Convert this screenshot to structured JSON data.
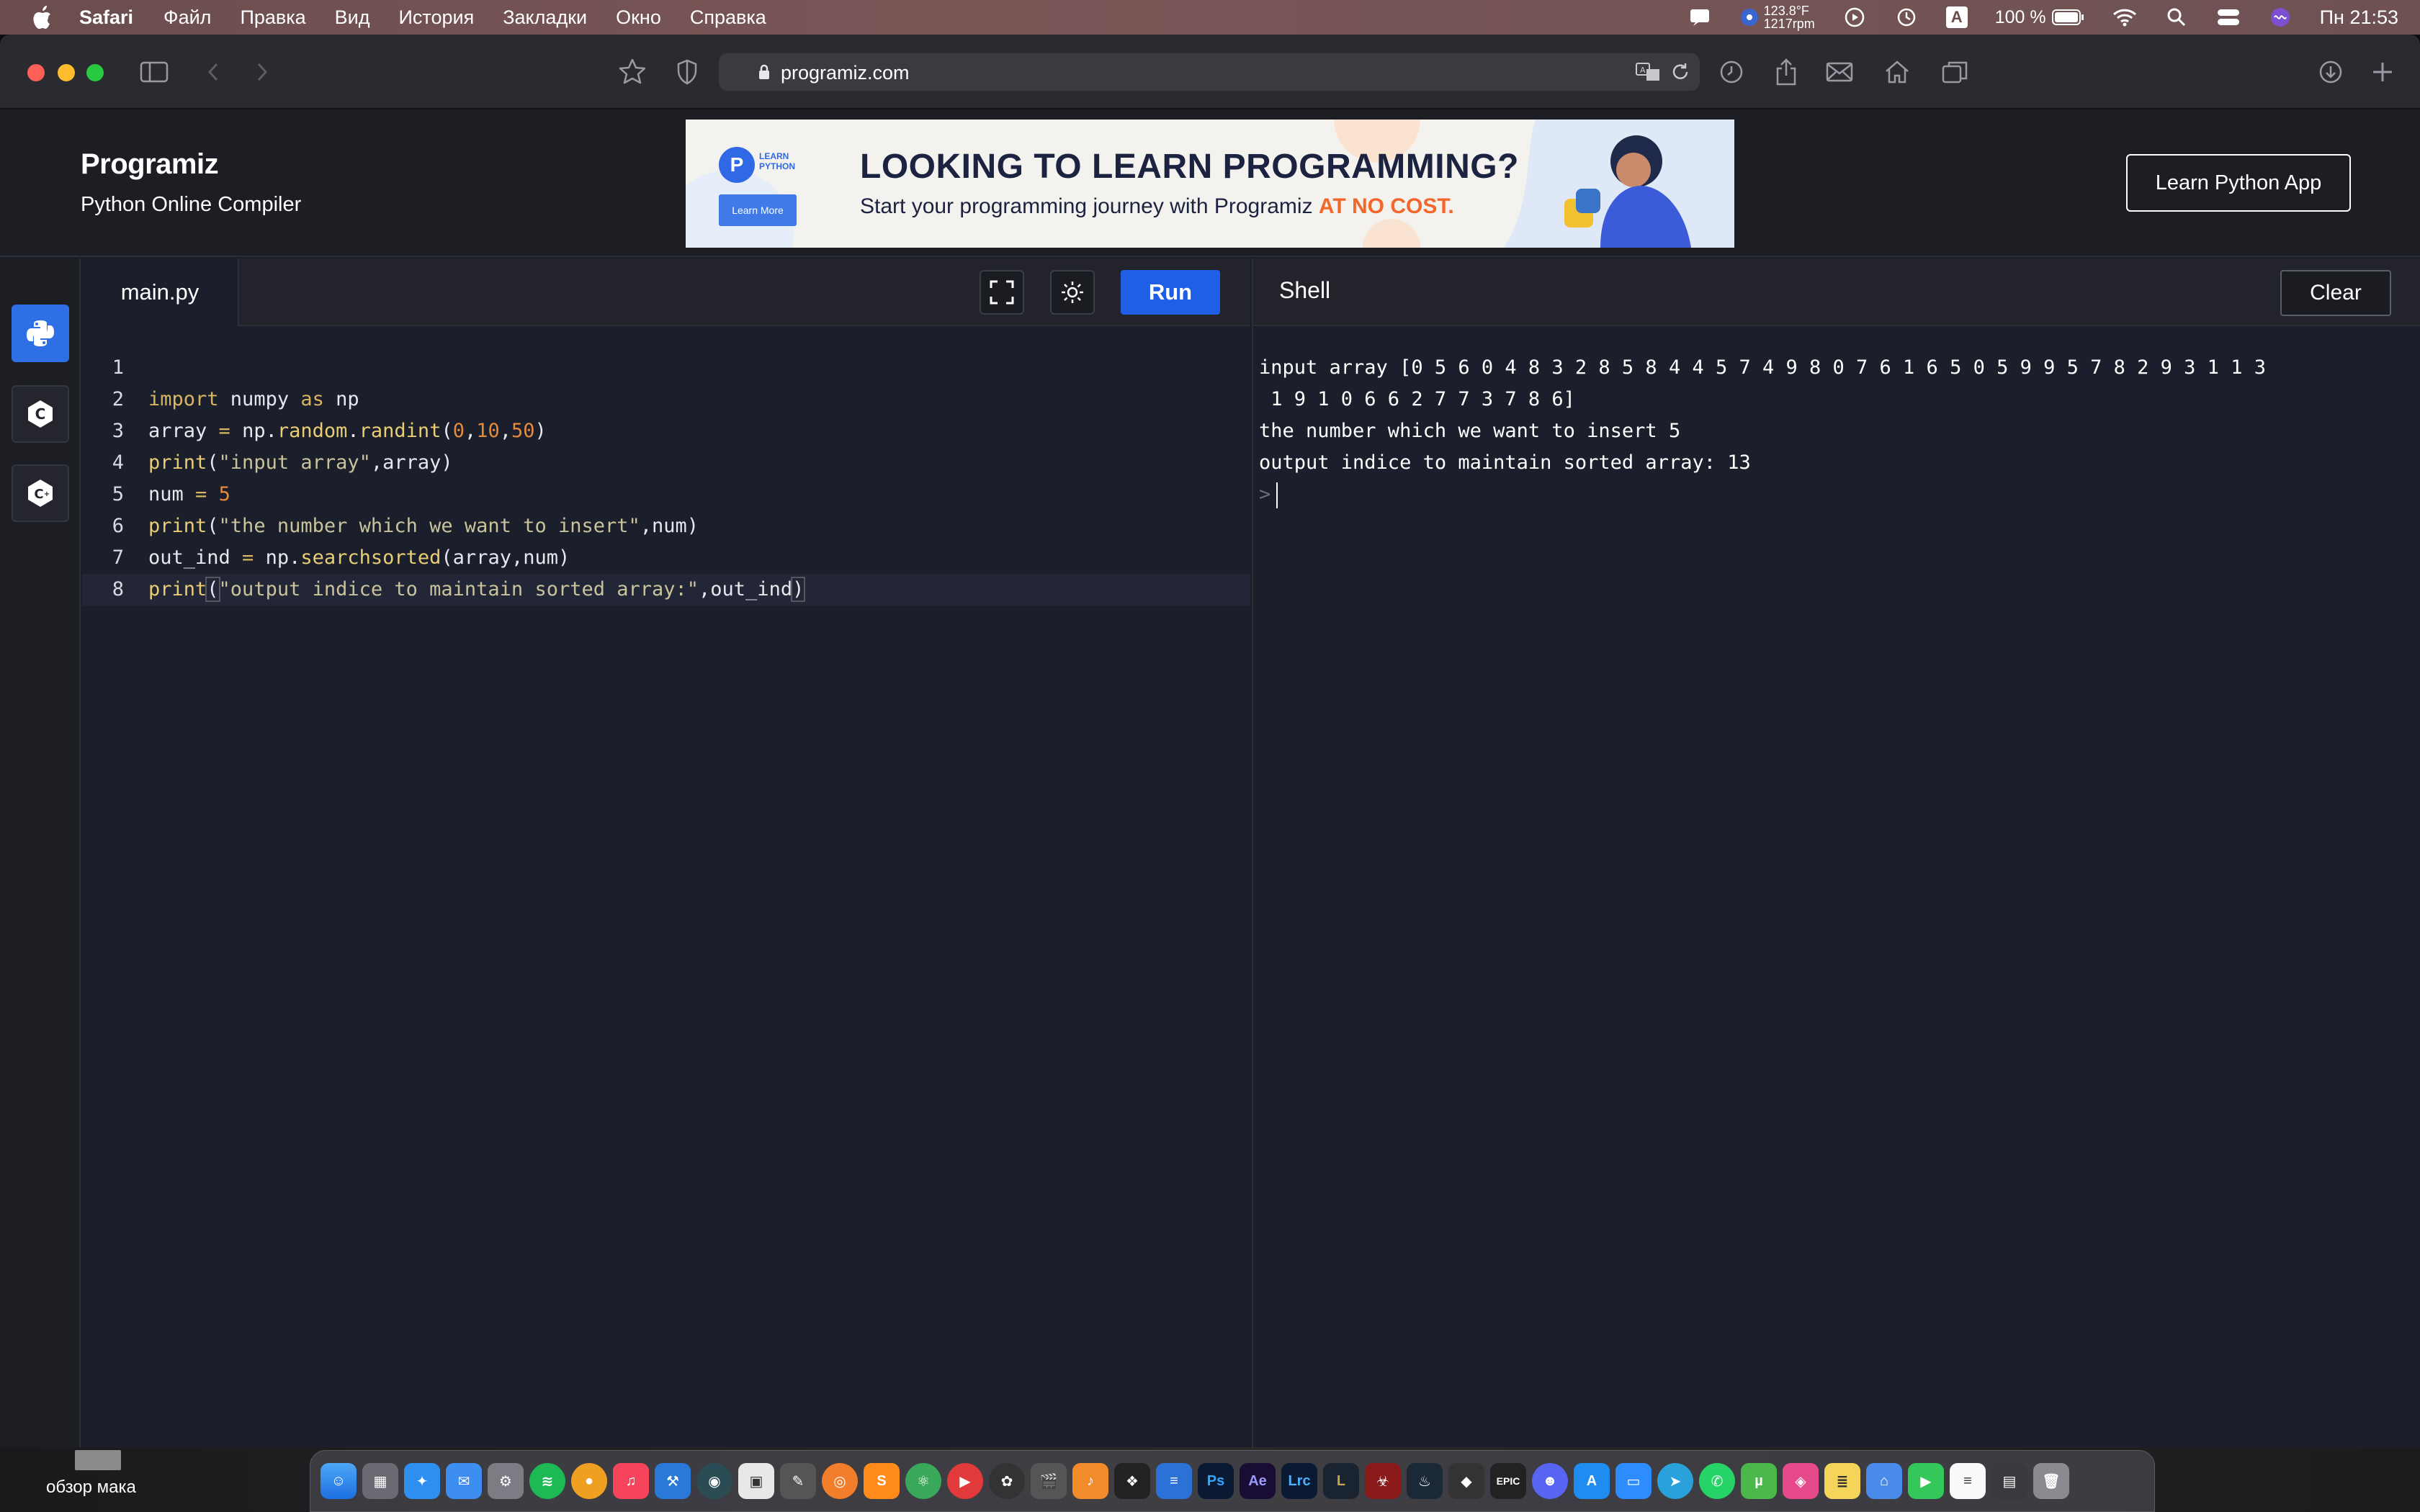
{
  "menubar": {
    "app_name": "Safari",
    "items": [
      "Файл",
      "Правка",
      "Вид",
      "История",
      "Закладки",
      "Окно",
      "Справка"
    ],
    "temp_line1": "123.8°F",
    "temp_line2": "1217rpm",
    "input_source": "A",
    "battery": "100 %",
    "clock": "Пн 21:53"
  },
  "browser": {
    "url": "programiz.com"
  },
  "site": {
    "logo": "Programiz",
    "subtitle": "Python Online Compiler",
    "learn_app_button": "Learn Python App",
    "banner": {
      "badge_text_1": "LEARN",
      "badge_text_2": "PYTHON",
      "button": "Learn More",
      "title": "LOOKING TO LEARN PROGRAMMING?",
      "subtitle_prefix": "Start your programming journey with Programiz ",
      "subtitle_highlight": "AT NO COST."
    }
  },
  "editor": {
    "tab": "main.py",
    "run_label": "Run",
    "lines": [
      "1",
      "2",
      "3",
      "4",
      "5",
      "6",
      "7",
      "8"
    ]
  },
  "shell": {
    "title": "Shell",
    "clear_label": "Clear",
    "output": [
      "input array [0 5 6 0 4 8 3 2 8 5 8 4 4 5 7 4 9 8 0 7 6 1 6 5 0 5 9 9 5 7 8 2 9 3 1 1 3",
      " 1 9 1 0 6 6 2 7 7 3 7 8 6]",
      "the number which we want to insert 5",
      "output indice to maintain sorted array: 13"
    ],
    "prompt": ">"
  },
  "desktop": {
    "label": "обзор мака"
  },
  "colors": {
    "accent": "#1f5fe6",
    "editor_bg": "#1b1e2b",
    "panel_bg": "#22232b"
  }
}
